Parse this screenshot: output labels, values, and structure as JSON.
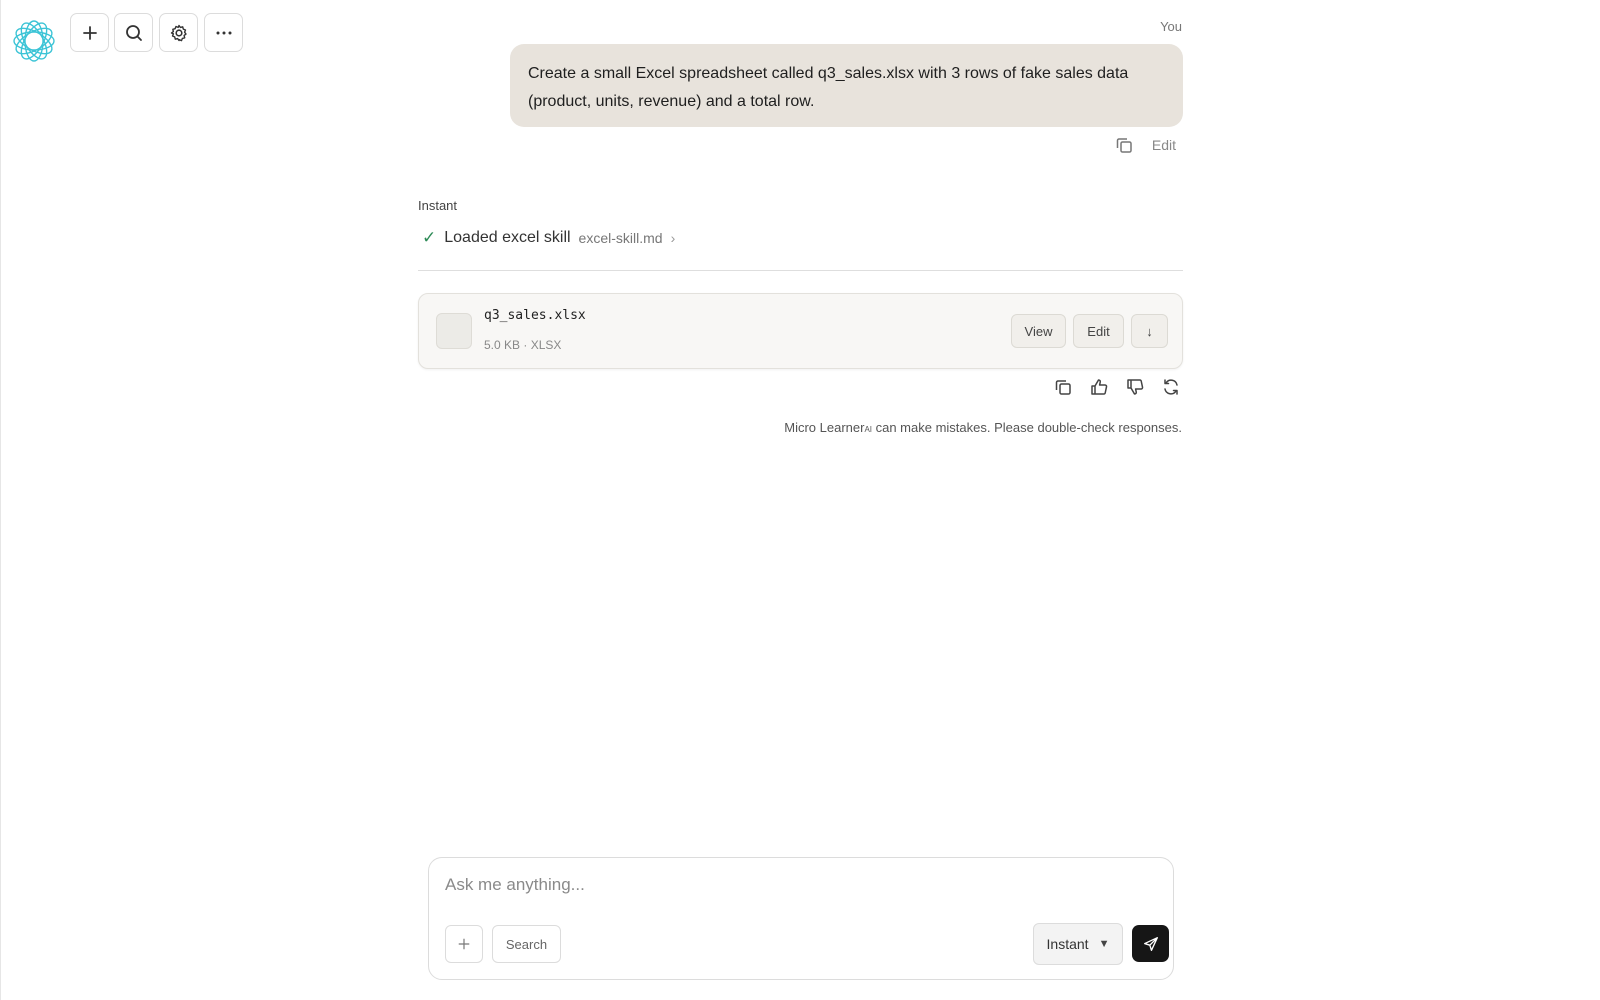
{
  "toolbar": {
    "logo_icon": "flower-logo-icon",
    "buttons": [
      {
        "icon": "plus-icon"
      },
      {
        "icon": "search-icon"
      },
      {
        "icon": "gear-icon"
      },
      {
        "icon": "more-horizontal-icon"
      }
    ]
  },
  "conversation": {
    "user_label": "You",
    "user_message": "Create a small Excel spreadsheet called q3_sales.xlsx with 3 rows of fake sales data (product, units, revenue) and a total row.",
    "user_actions": {
      "edit_label": "Edit"
    },
    "mode_label": "Instant",
    "skill": {
      "check": "✓",
      "title": "Loaded excel skill",
      "file": "excel-skill.md",
      "chevron": "›"
    },
    "file_card": {
      "name": "q3_sales.xlsx",
      "meta": "5.0 KB · XLSX",
      "view_label": "View",
      "edit_label": "Edit",
      "download_label": "↓"
    },
    "disclaimer": {
      "brand": "Micro Learner",
      "brand_sub": "AI",
      "text": " can make mistakes. Please double-check responses."
    }
  },
  "composer": {
    "placeholder": "Ask me anything...",
    "plus_label": "+",
    "search_label": "Search",
    "mode_label": "Instant",
    "mode_arrow": "▼"
  },
  "colors": {
    "user_bubble": "#e8e3dc",
    "logo": "#3cc4d6",
    "check": "#2e8b57",
    "send_button": "#161616"
  }
}
